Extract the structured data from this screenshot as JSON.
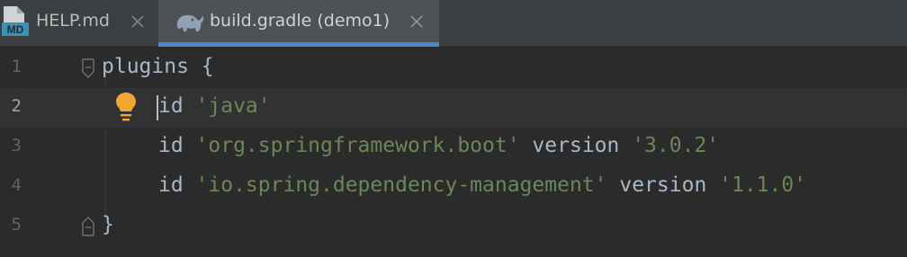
{
  "tabs": [
    {
      "icon": "markdown-file-icon",
      "icon_text": "MD",
      "label": "HELP.md",
      "active": false
    },
    {
      "icon": "gradle-elephant-icon",
      "label": "build.gradle (demo1)",
      "active": true
    }
  ],
  "editor": {
    "current_line": 2,
    "lines": [
      {
        "number": "1",
        "tokens": [
          {
            "text": "plugins {",
            "kind": "plain"
          }
        ]
      },
      {
        "number": "2",
        "tokens": [
          {
            "text": "id ",
            "kind": "plain"
          },
          {
            "text": "'java'",
            "kind": "string"
          }
        ]
      },
      {
        "number": "3",
        "tokens": [
          {
            "text": "id ",
            "kind": "plain"
          },
          {
            "text": "'org.springframework.boot'",
            "kind": "string"
          },
          {
            "text": " version ",
            "kind": "plain"
          },
          {
            "text": "'3.0.2'",
            "kind": "string"
          }
        ]
      },
      {
        "number": "4",
        "tokens": [
          {
            "text": "id ",
            "kind": "plain"
          },
          {
            "text": "'io.spring.dependency-management'",
            "kind": "string"
          },
          {
            "text": " version ",
            "kind": "plain"
          },
          {
            "text": "'1.1.0'",
            "kind": "string"
          }
        ]
      },
      {
        "number": "5",
        "tokens": [
          {
            "text": "}",
            "kind": "plain"
          }
        ]
      }
    ]
  },
  "colors": {
    "background": "#2b2b2b",
    "tab_bar": "#3c3f41",
    "active_tab": "#4e5254",
    "active_tab_underline": "#4a88c7",
    "string": "#6a8759",
    "identifier": "#a9b7c6",
    "line_number": "#606366",
    "bulb": "#f0a732"
  }
}
